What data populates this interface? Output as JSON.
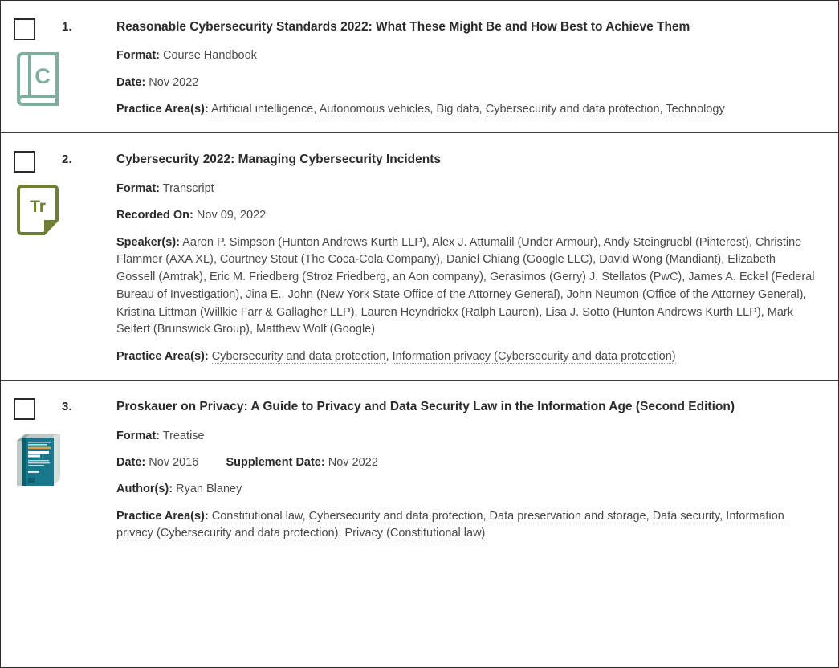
{
  "theme": {
    "page_border": "#2b2b2b",
    "divider": "#3c3c3c",
    "text": "#333333",
    "label": "#2b2b2b",
    "link_underline": "#8c8c8c",
    "icon_book_green": "#7fae9c",
    "icon_transcript_olive": "#6e7f33",
    "treatise_cover_teal": "#16788a"
  },
  "labels": {
    "format": "Format:",
    "date": "Date:",
    "recorded_on": "Recorded On:",
    "supplement_date": "Supplement Date:",
    "speakers": "Speaker(s):",
    "authors": "Author(s):",
    "practice_areas": "Practice Area(s):"
  },
  "results": [
    {
      "index": "1.",
      "icon": "course-handbook-book-icon",
      "icon_letter": "C",
      "title": "Reasonable Cybersecurity Standards 2022: What These Might Be and How Best to Achieve Them",
      "format": "Course Handbook",
      "date": "Nov 2022",
      "practice_areas": [
        "Artificial intelligence",
        "Autonomous vehicles",
        "Big data",
        "Cybersecurity and data protection",
        "Technology"
      ]
    },
    {
      "index": "2.",
      "icon": "transcript-document-icon",
      "icon_letter": "Tr",
      "title": "Cybersecurity 2022: Managing Cybersecurity Incidents",
      "format": "Transcript",
      "recorded_on": "Nov 09, 2022",
      "speakers": "Aaron P. Simpson (Hunton Andrews Kurth LLP), Alex J. Attumalil (Under Armour), Andy Steingruebl (Pinterest), Christine Flammer (AXA XL), Courtney Stout (The Coca-Cola Company), Daniel Chiang (Google LLC), David Wong (Mandiant), Elizabeth Gossell (Amtrak), Eric M. Friedberg (Stroz Friedberg, an Aon company), Gerasimos (Gerry) J. Stellatos (PwC), James A. Eckel (Federal Bureau of Investigation), Jina E.. John (New York State Office of the Attorney General), John Neumon (Office of the Attorney General), Kristina Littman (Willkie Farr & Gallagher LLP), Lauren Heyndrickx (Ralph Lauren), Lisa J. Sotto (Hunton Andrews Kurth LLP), Mark Seifert (Brunswick Group), Matthew Wolf (Google)",
      "practice_areas": [
        "Cybersecurity and data protection",
        "Information privacy (Cybersecurity and data protection)"
      ]
    },
    {
      "index": "3.",
      "icon": "treatise-book-cover-image",
      "cover_title_line1": "Proskauer on",
      "cover_title_line2": "Privacy",
      "cover_subtitle": "A Guide to Privacy and Data Security Law in the Information Age",
      "cover_edition": "Second Edition",
      "title": "Proskauer on Privacy: A Guide to Privacy and Data Security Law in the Information Age (Second Edition)",
      "format": "Treatise",
      "date": "Nov 2016",
      "supplement_date": "Nov 2022",
      "authors": "Ryan Blaney",
      "practice_areas": [
        "Constitutional law",
        "Cybersecurity and data protection",
        "Data preservation and storage",
        "Data security",
        "Information privacy (Cybersecurity and data protection)",
        "Privacy (Constitutional law)"
      ]
    }
  ]
}
